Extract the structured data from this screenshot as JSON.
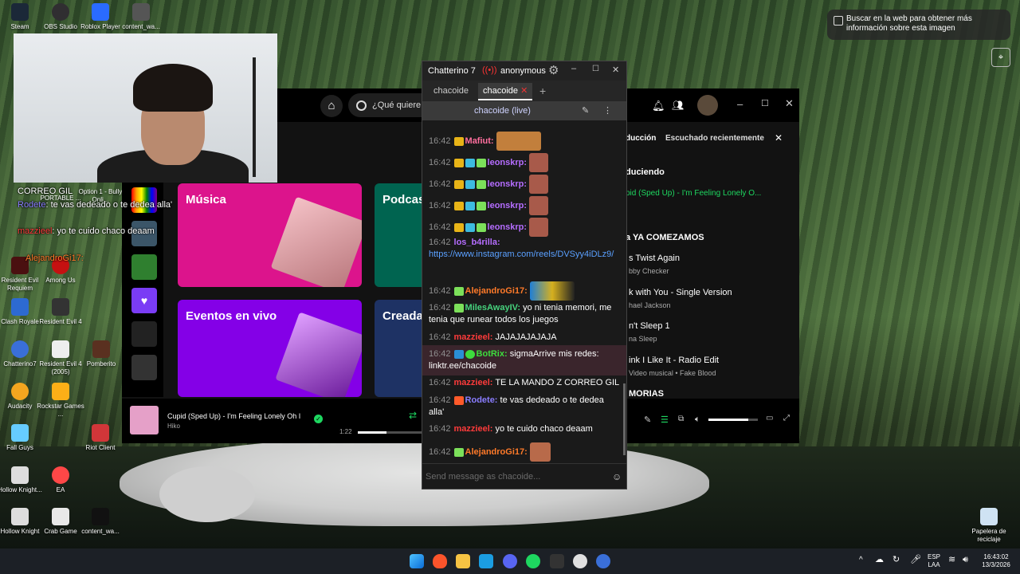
{
  "desktop": {
    "icons": [
      {
        "label": "Steam"
      },
      {
        "label": "OBS Studio"
      },
      {
        "label": "Roblox Player"
      },
      {
        "label": "content_wa..."
      },
      {
        "label": "Resident Evil Requiem"
      },
      {
        "label": "Among Us"
      },
      {
        "label": "Clash Royale"
      },
      {
        "label": "Resident Evil 4"
      },
      {
        "label": "Chatterino7"
      },
      {
        "label": "Resident Evil 4 (2005)"
      },
      {
        "label": "Pomberito"
      },
      {
        "label": "Audacity"
      },
      {
        "label": "Rockstar Games ..."
      },
      {
        "label": "Fall Guys"
      },
      {
        "label": "Riot Client"
      },
      {
        "label": "Hollow Knight..."
      },
      {
        "label": "EA"
      },
      {
        "label": "Hollow Knight"
      },
      {
        "label": "Crab Game"
      },
      {
        "label": "content_wa..."
      },
      {
        "label": "Papelera de reciclaje"
      },
      {
        "label": "Option 1 - Bully Onli..."
      },
      {
        "label": "PORTABLE ..."
      }
    ],
    "lens_tooltip": "Buscar en la web para obtener más información sobre esta imagen"
  },
  "overlay_chat": [
    {
      "user": "CORREO GIL",
      "text": ""
    },
    {
      "user": "Rodete",
      "text": ": te vas dedeado o te dedea alla'"
    },
    {
      "user": "mazzieel",
      "text": ": yo te cuido chaco deaam"
    },
    {
      "user": "AlejandroGi17:",
      "text": ""
    }
  ],
  "spotify": {
    "search_placeholder": "¿Qué quiere",
    "cards": {
      "music": "Música",
      "podcasts": "Podcas",
      "events": "Eventos en vivo",
      "created": "Creada"
    },
    "tabs": {
      "queue": "ducción",
      "recent": "Escuchado recientemente"
    },
    "now_playing_header": "duciendo",
    "queue_current": "pid (Sped Up) - I'm Feeling Lonely O...",
    "next_header": "a YA COMEZAMOS",
    "queue": [
      {
        "title": "s Twist Again",
        "artist": "bby Checker"
      },
      {
        "title": "k with You - Single Version",
        "artist": "hael Jackson"
      },
      {
        "title": "n't Sleep 1",
        "artist": "na Sleep"
      },
      {
        "title": "ink I Like It - Radio Edit",
        "artist": "Video musical • Fake Blood"
      },
      {
        "title": "MORIAS",
        "artist": ""
      }
    ],
    "player": {
      "track": "Cupid (Sped Up) - I'm Feeling Lonely Oh I",
      "artist": "Hiko",
      "elapsed": "1:22",
      "progress": 0.45,
      "volume": 0.8
    }
  },
  "chatterino": {
    "title": "Chatterino 7",
    "user": "anonymous",
    "tabs": [
      "chacoide",
      "chacoide"
    ],
    "split_title": "chacoide (live)",
    "messages": [
      {
        "time": "16:42",
        "user": "Mafiut:",
        "text": "",
        "color": "#ff6f9e"
      },
      {
        "time": "16:42",
        "user": "leonskrp:",
        "text": "",
        "color": "#b56dff"
      },
      {
        "time": "16:42",
        "user": "leonskrp:",
        "text": "",
        "color": "#b56dff"
      },
      {
        "time": "16:42",
        "user": "leonskrp:",
        "text": "",
        "color": "#b56dff"
      },
      {
        "time": "16:42",
        "user": "leonskrp:",
        "text": "",
        "color": "#b56dff"
      },
      {
        "time": "16:42",
        "user": "los_b4rilla:",
        "text": "https://www.instagram.com/reels/DVSyy4iDLz9/",
        "color": "#b56dff"
      },
      {
        "time": "16:42",
        "user": "AlejandroGi17:",
        "text": "",
        "color": "#ff7a29"
      },
      {
        "time": "16:42",
        "user": "MilesAwayIV:",
        "text": "yo ni tenia memori, me tenia que runear todos los juegos",
        "color": "#46d37d"
      },
      {
        "time": "16:42",
        "user": "mazzieel:",
        "text": "JAJAJAJAJAJA",
        "color": "#ff3b3b"
      },
      {
        "time": "16:42",
        "user": "BotRix:",
        "text": "sigmaArrive mis redes: linktr.ee/chacoide",
        "color": "#3ddc3d"
      },
      {
        "time": "16:42",
        "user": "mazzieel:",
        "text": "TE LA MANDO Z CORREO GIL",
        "color": "#ff3b3b"
      },
      {
        "time": "16:42",
        "user": "Rodete:",
        "text": "te vas dedeado o te dedea alla'",
        "color": "#8a7dff"
      },
      {
        "time": "16:42",
        "user": "mazzieel:",
        "text": "yo te cuido chaco deaam",
        "color": "#ff3b3b"
      },
      {
        "time": "16:42",
        "user": "AlejandroGi17:",
        "text": "",
        "color": "#ff7a29"
      }
    ],
    "input_placeholder": "Send message as chacoide..."
  },
  "taskbar": {
    "lang": "ESP",
    "region": "LAA",
    "time": "16:43:02",
    "date": "13/3/2026"
  },
  "colors": {
    "spotify_green": "#1ed760",
    "chat_bg": "#1a1a1a",
    "link": "#5aa0ff"
  }
}
